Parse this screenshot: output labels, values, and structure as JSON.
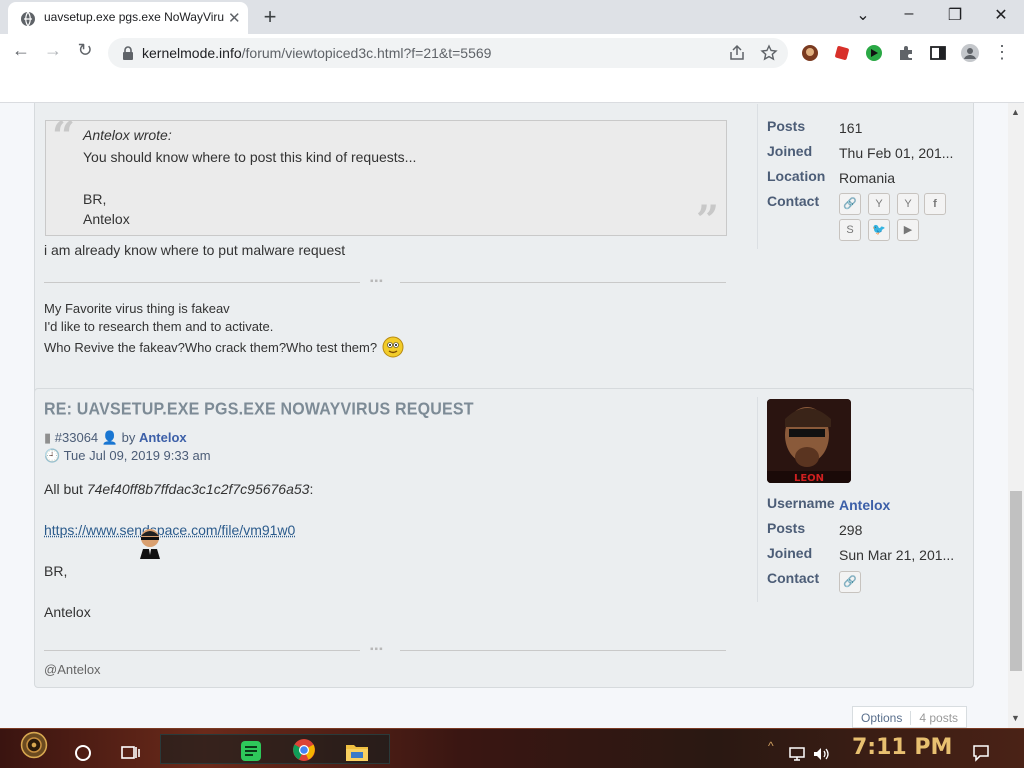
{
  "browser": {
    "tab_title": "uavsetup.exe pgs.exe NoWayViru",
    "url_domain": "kernelmode.info",
    "url_path": "/forum/viewtopiced3c.html?f=21&t=5569"
  },
  "post1": {
    "quote": {
      "author": "Antelox wrote:",
      "line1": "You should know where to post this kind of requests...",
      "line2": "BR,",
      "line3": "Antelox"
    },
    "reply": "i am already know where to put malware request",
    "signature": [
      "My Favorite virus thing is fakeav",
      "I'd like to research them and to activate.",
      "Who Revive the fakeav?Who crack them?Who test them?"
    ],
    "profile": {
      "posts_label": "Posts",
      "posts_value": "161",
      "joined_label": "Joined",
      "joined_value": "Thu Feb 01, 201...",
      "location_label": "Location",
      "location_value": "Romania",
      "contact_label": "Contact"
    }
  },
  "post2": {
    "title": "RE: UAVSETUP.EXE PGS.EXE NOWAYVIRUS REQUEST",
    "post_id": "#33064",
    "by": "by",
    "author": "Antelox",
    "date": "Tue Jul 09, 2019 9:33 am",
    "body_prefix": "All but ",
    "hash": "74ef40ff8b7ffdac3c1c2f7c95676a53",
    "body_suffix": ":",
    "link": "https://www.sendspace.com/file/vm91w0",
    "br": "BR,",
    "signoff": "Antelox",
    "signature": "@Antelox",
    "avatar_caption": "LEON",
    "profile": {
      "username_label": "Username",
      "username_value": "Antelox",
      "posts_label": "Posts",
      "posts_value": "298",
      "joined_label": "Joined",
      "joined_value": "Sun Mar 21, 201...",
      "contact_label": "Contact"
    }
  },
  "pagination": {
    "options": "Options",
    "posts": "4 posts"
  },
  "taskbar": {
    "clock": "7:11 PM"
  },
  "colors": {
    "accent": "#3c5fa8",
    "label": "#4c5d77",
    "clock": "#e8c070"
  }
}
